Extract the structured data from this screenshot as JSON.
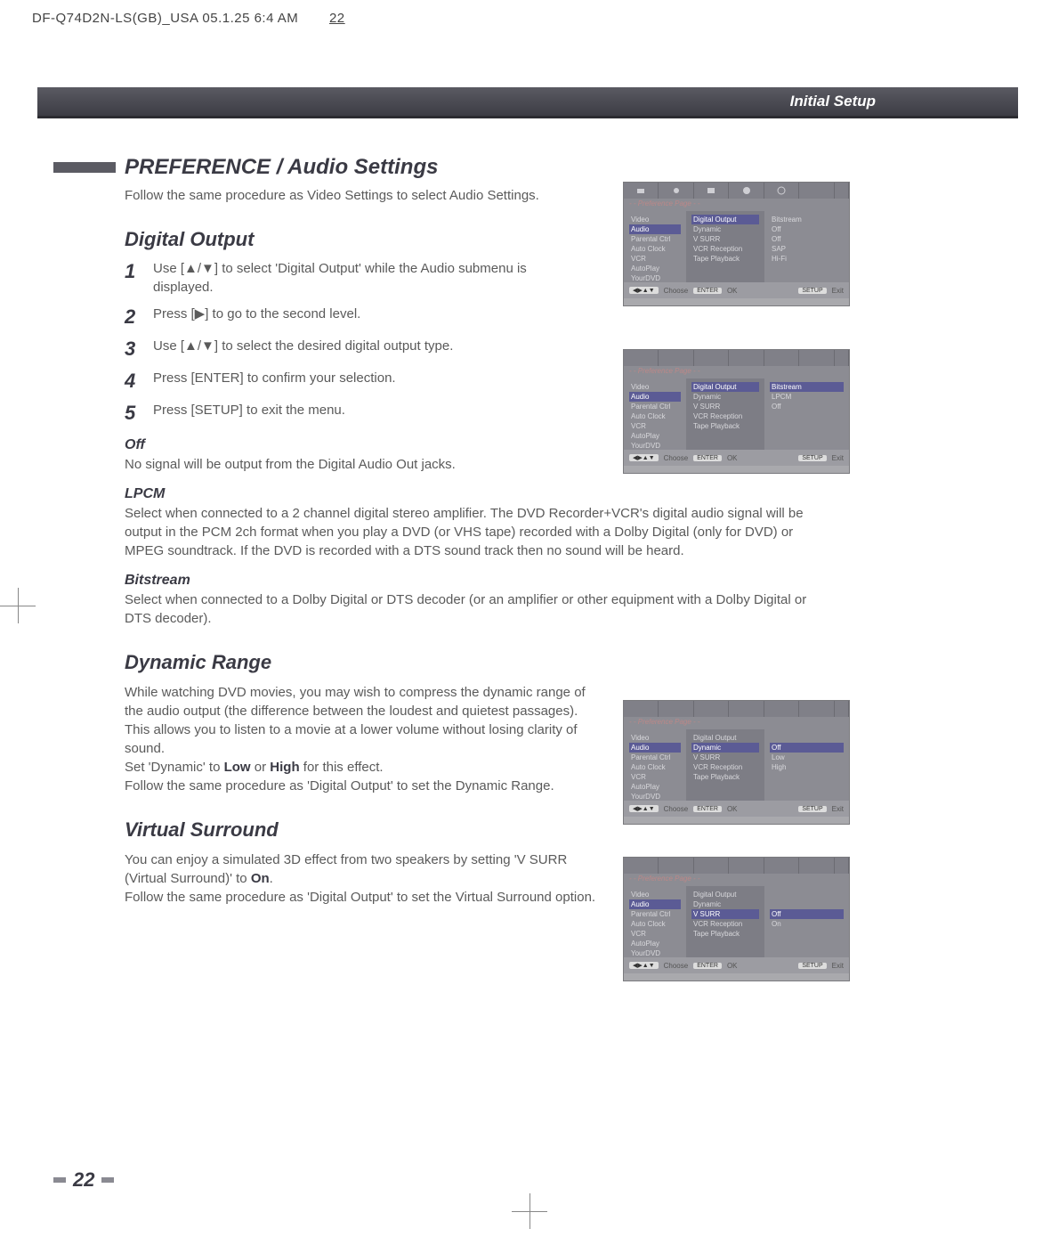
{
  "meta": {
    "doc_header": "DF-Q74D2N-LS(GB)_USA   05.1.25  6:4 AM",
    "doc_page_mark": "22"
  },
  "topband": {
    "title": "Initial Setup"
  },
  "section": {
    "title": "PREFERENCE / Audio Settings"
  },
  "intro": "Follow the same procedure as Video Settings to select Audio Settings.",
  "digital_output": {
    "heading": "Digital Output",
    "steps": [
      "Use [▲/▼] to select 'Digital Output' while the Audio submenu is displayed.",
      "Press [▶] to go to the second level.",
      "Use [▲/▼] to select the desired digital output type.",
      "Press [ENTER] to confirm your selection.",
      "Press [SETUP] to exit the menu."
    ],
    "off_head": "Off",
    "off_text": "No signal will be output from the Digital Audio Out jacks.",
    "lpcm_head": "LPCM",
    "lpcm_text": "Select when connected to a 2 channel digital stereo amplifier. The DVD Recorder+VCR's digital audio signal will be output in the PCM 2ch format when you play a DVD (or VHS tape) recorded with a Dolby Digital (only for DVD) or MPEG soundtrack. If the DVD is recorded with a DTS sound track then no sound will be heard.",
    "bit_head": "Bitstream",
    "bit_text": "Select when connected to a Dolby Digital or DTS decoder (or an amplifier or other equipment with a Dolby Digital or DTS decoder)."
  },
  "dynamic": {
    "heading": "Dynamic Range",
    "p1": "While watching DVD movies, you may wish to compress the dynamic range of the audio output (the difference between the loudest and quietest passages). This allows you to listen to a movie at a lower volume without losing clarity of sound.",
    "p2a": "Set 'Dynamic' to ",
    "low": "Low",
    "or": " or ",
    "high": "High",
    "p2b": " for this effect.",
    "p3": "Follow the same procedure as 'Digital Output' to set the Dynamic Range."
  },
  "vsurr": {
    "heading": "Virtual Surround",
    "p1a": "You can enjoy a simulated 3D effect from two speakers by setting 'V SURR (Virtual Surround)' to ",
    "on": "On",
    "p1b": ".",
    "p2": "Follow the same procedure as 'Digital Output' to set the Virtual Surround option."
  },
  "page_number": "22",
  "osd_common": {
    "crumb": "- - Preference Page - -",
    "left_items": [
      "Video",
      "Audio",
      "Parental Ctrl",
      "Auto Clock",
      "VCR",
      "AutoPlay",
      "YourDVD"
    ],
    "mid_items": [
      "Digital Output",
      "Dynamic",
      "V SURR",
      "VCR Reception",
      "Tape Playback"
    ],
    "footer_choose": "Choose",
    "footer_ok": "OK",
    "footer_exit": "Exit",
    "key_arrows": "◀▶▲▼",
    "key_enter": "ENTER",
    "key_setup": "SETUP"
  },
  "osd1_right": [
    "Bitstream",
    "Off",
    "Off",
    "SAP",
    "Hi-Fi"
  ],
  "osd2_right": [
    "Bitstream",
    "LPCM",
    "Off"
  ],
  "osd3_right": [
    "Off",
    "Low",
    "High"
  ],
  "osd4_right": [
    "Off",
    "On"
  ]
}
